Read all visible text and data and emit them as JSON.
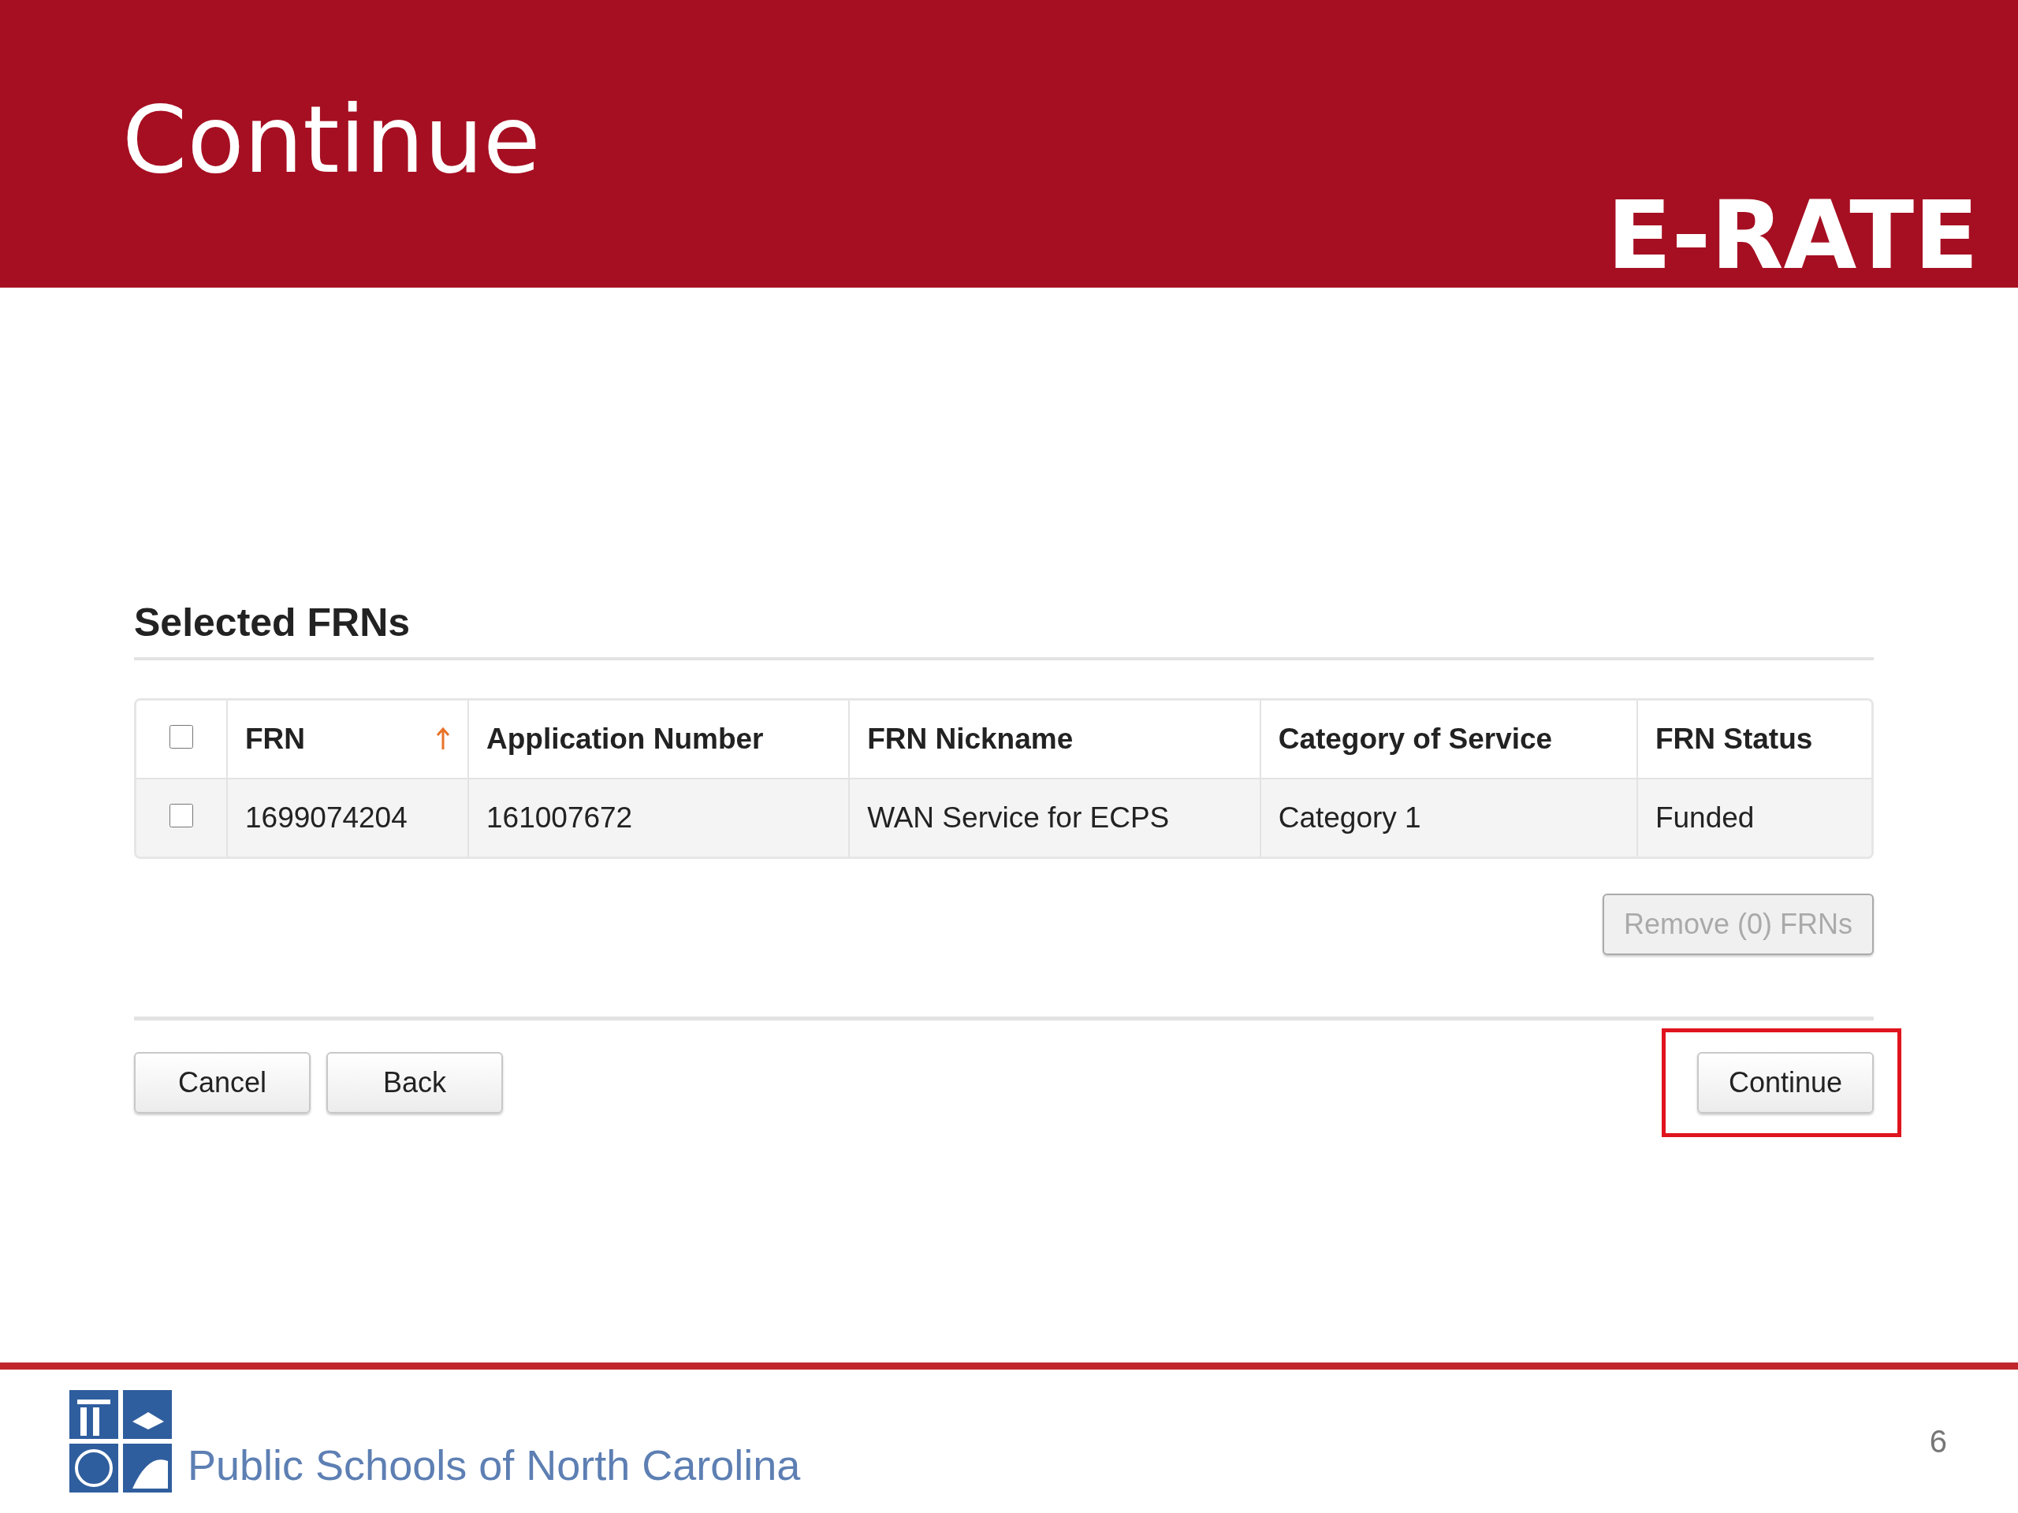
{
  "slide": {
    "title": "Continue",
    "brand": "E-RATE"
  },
  "section": {
    "title": "Selected FRNs"
  },
  "table": {
    "select_all_checked": false,
    "columns": [
      {
        "label": "FRN",
        "sorted": true
      },
      {
        "label": "Application Number",
        "sorted": false
      },
      {
        "label": "FRN Nickname",
        "sorted": false
      },
      {
        "label": "Category of Service",
        "sorted": false
      },
      {
        "label": "FRN Status",
        "sorted": false
      }
    ],
    "rows": [
      {
        "checked": false,
        "cells": [
          "1699074204",
          "161007672",
          "WAN Service for ECPS",
          "Category 1",
          "Funded"
        ]
      }
    ]
  },
  "remove_button": {
    "label": "Remove (0) FRNs",
    "disabled": true
  },
  "buttons": [
    {
      "label": "Cancel",
      "highlighted": false
    },
    {
      "label": "Back",
      "highlighted": false
    },
    {
      "label": "Continue",
      "highlighted": true
    }
  ],
  "footer": {
    "organization": "Public Schools of North Carolina",
    "page_number": "6"
  }
}
